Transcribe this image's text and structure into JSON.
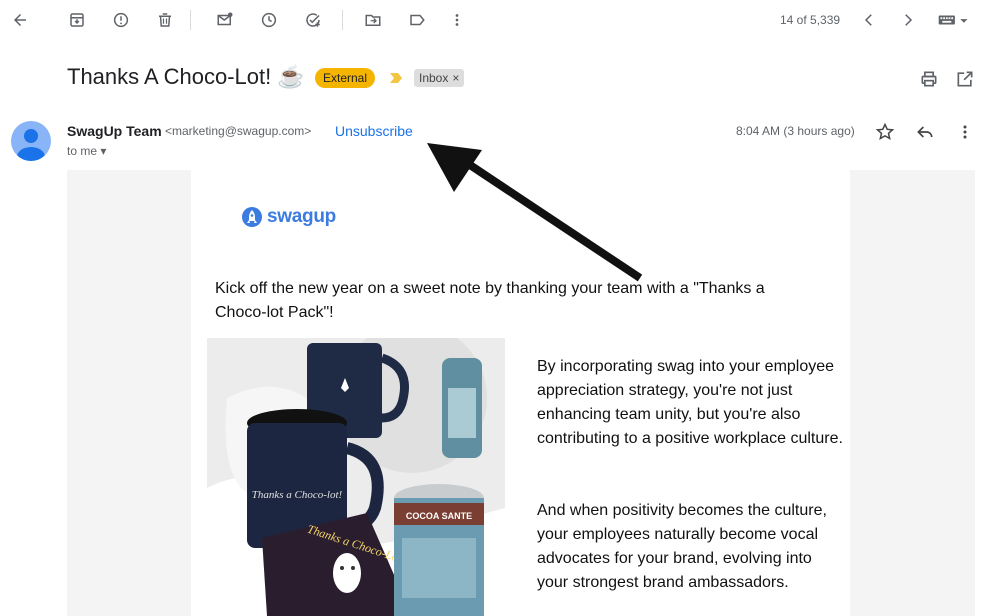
{
  "toolbar": {
    "pager_count": "14 of 5,339",
    "icons": [
      "back-arrow-icon",
      "archive-icon",
      "report-spam-icon",
      "delete-icon",
      "mark-unread-icon",
      "snooze-icon",
      "add-task-icon",
      "move-to-icon",
      "label-icon",
      "more-vert-icon",
      "chevron-left-icon",
      "chevron-right-icon",
      "keyboard-icon"
    ]
  },
  "subject": {
    "title": "Thanks A Choco-Lot! ☕",
    "external_label": "External",
    "inbox_label": "Inbox",
    "inbox_remove": "×"
  },
  "sender": {
    "name": "SwagUp Team",
    "email": "<marketing@swagup.com>",
    "unsubscribe": "Unsubscribe",
    "to": "to me",
    "time": "8:04 AM (3 hours ago)"
  },
  "email_body": {
    "logo_text": "swagup",
    "intro": "Kick off the new year on a sweet note by thanking your team with a \"Thanks a Choco-lot Pack\"!",
    "paragraph1": "By incorporating swag into your employee appreciation strategy, you're not just enhancing team unity, but you're also contributing to a positive workplace culture.",
    "paragraph2": "And when positivity becomes the culture, your employees naturally become vocal advocates for your brand, evolving into your strongest brand ambassadors.",
    "photo": {
      "mug_text": "Thanks a Choco-lot!",
      "card_text": "Thanks a Choco-Lot!",
      "can_text": "COCOA SANTE"
    }
  },
  "colors": {
    "external_badge": "#f4b400",
    "link": "#1a73e8",
    "logo": "#3c7be0",
    "avatar": "#8ab4f8"
  }
}
